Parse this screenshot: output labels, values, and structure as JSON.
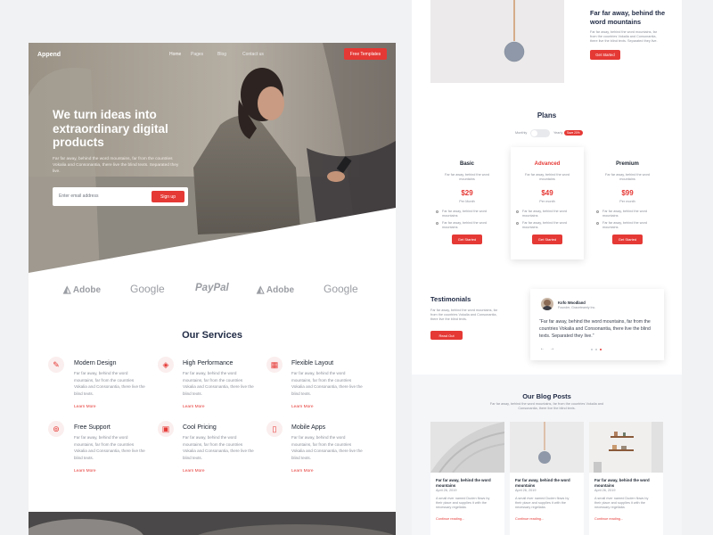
{
  "nav": {
    "brand": "Append",
    "links": [
      "Home",
      "Pages",
      "Blog",
      "Contact us"
    ],
    "cta": "Free Templates"
  },
  "hero": {
    "title": "We turn ideas into extraordinary digital products",
    "text": "Far far away, behind the word mountains, far from the countries Vokalia and Consonantia, there live the blind texts. Separated they live.",
    "email_placeholder": "Enter email address",
    "signup": "Sign up"
  },
  "logos": [
    "Adobe",
    "Google",
    "PayPal",
    "Adobe",
    "Google"
  ],
  "services": {
    "title": "Our Services",
    "desc": "Far far away, behind the word mountains, far from the countries Vokalia and Consonantia, there live the blind texts.",
    "more": "Learn More",
    "items": [
      {
        "title": "Modern Design",
        "icon": "brush-icon"
      },
      {
        "title": "High Performance",
        "icon": "layers-icon"
      },
      {
        "title": "Flexible Layout",
        "icon": "layout-icon"
      },
      {
        "title": "Free Support",
        "icon": "lifebuoy-icon"
      },
      {
        "title": "Cool Pricing",
        "icon": "bag-icon"
      },
      {
        "title": "Mobile Apps",
        "icon": "phone-icon"
      }
    ]
  },
  "feature": {
    "title": "Far far away, behind the word mountains",
    "text": "Far far away, behind the word mountains, far from the countries Vokalia and Consonantia, there live the blind texts. Separated they live.",
    "button": "Get Started"
  },
  "plans": {
    "title": "Plans",
    "monthly": "Monthly",
    "yearly": "Yearly",
    "save": "Save 20%",
    "items": [
      {
        "name": "Basic",
        "text": "Far far away, behind the word mountains",
        "price": "$29",
        "per": "Per Month",
        "f1": "Far far away, behind the word mountains",
        "f2": "Far far away, behind the word mountains",
        "button": "Get Started"
      },
      {
        "name": "Advanced",
        "text": "Far far away, behind the word mountains",
        "price": "$49",
        "per": "Per month",
        "f1": "Far far away, behind the word mountains",
        "f2": "Far far away, behind the word mountains",
        "button": "Get Started"
      },
      {
        "name": "Premium",
        "text": "Far far away, behind the word mountains",
        "price": "$99",
        "per": "Per month",
        "f1": "Far far away, behind the word mountains",
        "f2": "Far far away, behind the word mountains",
        "button": "Get Started"
      }
    ]
  },
  "testimonials": {
    "title": "Testimonials",
    "text": "Far far away, behind the word mountains, far from the countries Vokalia and Consonantia, there live the blind texts.",
    "button": "Read Out",
    "name": "Kofo Woodland",
    "role": "Founder, Graceteamly Inc.",
    "quote": "“Far far away, behind the word mountains, far from the countries Vokalia and Consonantia, there live the blind texts. Separated they live.”",
    "prev": "←",
    "next": "→"
  },
  "blog": {
    "title": "Our Blog Posts",
    "sub": "Far far away, behind the word mountains, far from the countries Vokalia and Consonantia, there live the blind texts.",
    "posts": [
      {
        "title": "Far far away, behind the word mountains",
        "date": "April 26, 2019",
        "text": "A small river named Duden flows by their place and supplies it with the necessary regelialia.",
        "more": "Continue reading..."
      },
      {
        "title": "Far far away, behind the word mountains",
        "date": "April 26, 2019",
        "text": "A small river named Duden flows by their place and supplies it with the necessary regelialia.",
        "more": "Continue reading..."
      },
      {
        "title": "Far far away, behind the word mountains",
        "date": "April 26, 2019",
        "text": "A small river named Duden flows by their place and supplies it with the necessary regelialia.",
        "more": "Continue reading..."
      }
    ]
  }
}
